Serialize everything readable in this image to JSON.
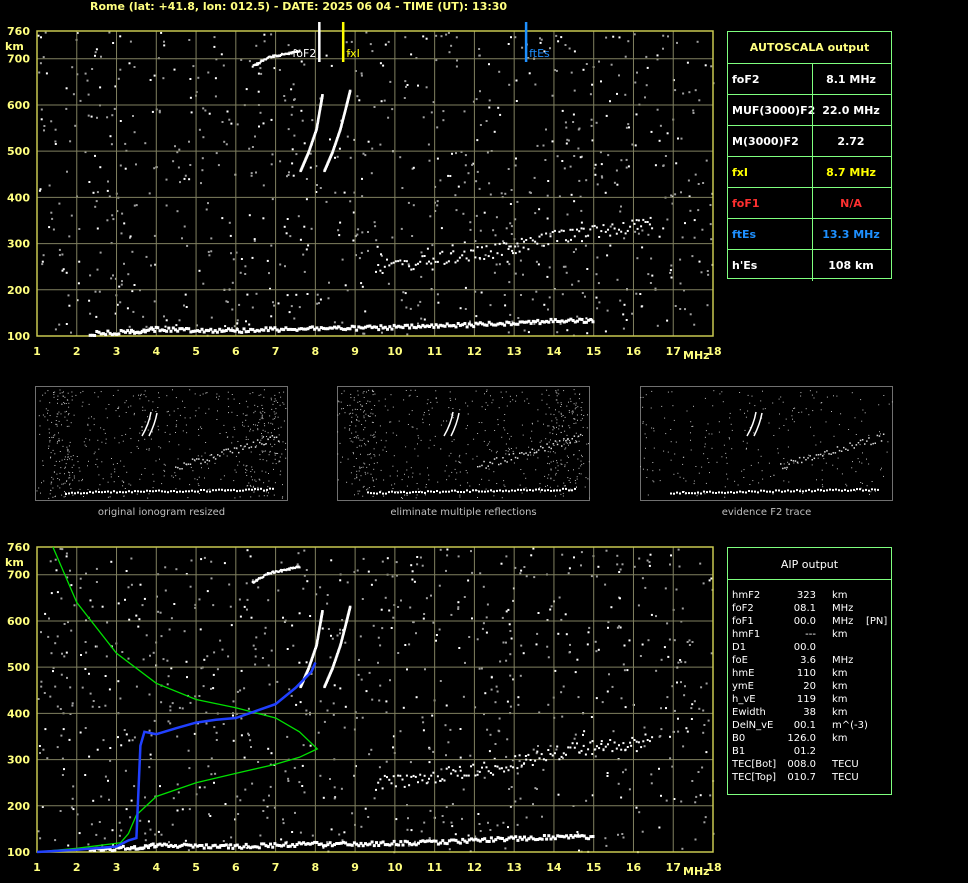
{
  "header": {
    "title": "Rome (lat: +41.8, lon: 012.5) - DATE: 2025 06 04 - TIME (UT): 13:30"
  },
  "colors": {
    "yellow": "#ffff00",
    "red": "#ff3030",
    "blue": "#1e90ff",
    "green": "#7fff7f",
    "grid": "#808060",
    "profile": "#00e000"
  },
  "autoscala": {
    "title": "AUTOSCALA output",
    "rows": [
      {
        "key": "foF2",
        "value": "8.1 MHz",
        "color": "#ffffff"
      },
      {
        "key": "MUF(3000)F2",
        "value": "22.0 MHz",
        "color": "#ffffff"
      },
      {
        "key": "M(3000)F2",
        "value": "2.72",
        "color": "#ffffff"
      },
      {
        "key": "fxI",
        "value": "8.7 MHz",
        "color": "#ffff00"
      },
      {
        "key": "foF1",
        "value": "N/A",
        "color": "#ff3030"
      },
      {
        "key": "ftEs",
        "value": "13.3 MHz",
        "color": "#1e90ff"
      },
      {
        "key": "h'Es",
        "value": "108     km",
        "color": "#ffffff"
      }
    ]
  },
  "aip": {
    "title": "AIP output",
    "rows": [
      {
        "k": "hmF2",
        "v": "323",
        "u": "km",
        "x": ""
      },
      {
        "k": "foF2",
        "v": "08.1",
        "u": "MHz",
        "x": ""
      },
      {
        "k": "foF1",
        "v": "00.0",
        "u": "MHz",
        "x": "[PN]"
      },
      {
        "k": "hmF1",
        "v": "---",
        "u": "km",
        "x": ""
      },
      {
        "k": "D1",
        "v": "00.0",
        "u": "",
        "x": ""
      },
      {
        "k": "foE",
        "v": "3.6",
        "u": "MHz",
        "x": ""
      },
      {
        "k": "hmE",
        "v": "110",
        "u": "km",
        "x": ""
      },
      {
        "k": "ymE",
        "v": "20",
        "u": "km",
        "x": ""
      },
      {
        "k": "h_vE",
        "v": "119",
        "u": "km",
        "x": ""
      },
      {
        "k": "Ewidth",
        "v": "38",
        "u": "km",
        "x": ""
      },
      {
        "k": "DelN_vE",
        "v": "00.1",
        "u": "m^(-3)",
        "x": ""
      },
      {
        "k": "B0",
        "v": "126.0",
        "u": "km",
        "x": ""
      },
      {
        "k": "B1",
        "v": "01.2",
        "u": "",
        "x": ""
      },
      {
        "k": "TEC[Bot]",
        "v": "008.0",
        "u": "TECU",
        "x": ""
      },
      {
        "k": "TEC[Top]",
        "v": "010.7",
        "u": "TECU",
        "x": ""
      }
    ]
  },
  "thumbnails": [
    {
      "caption": "original ionogram resized"
    },
    {
      "caption": "eliminate multiple reflections"
    },
    {
      "caption": "evidence F2 trace"
    }
  ],
  "chart_data": [
    {
      "type": "scatter",
      "name": "ionogram-autoscala",
      "xlabel": "MHz",
      "ylabel": "km",
      "xlim": [
        1,
        18
      ],
      "ylim": [
        100,
        760
      ],
      "xticks": [
        1,
        2,
        3,
        4,
        5,
        6,
        7,
        8,
        9,
        10,
        11,
        12,
        13,
        14,
        15,
        16,
        17,
        18
      ],
      "yticks": [
        100,
        200,
        300,
        400,
        500,
        600,
        700,
        760
      ],
      "markers": [
        {
          "label": "foF2",
          "freq": 8.1,
          "color": "#ffffff"
        },
        {
          "label": "fxI",
          "freq": 8.7,
          "color": "#ffff00"
        },
        {
          "label": "ftEs",
          "freq": 13.3,
          "color": "#1e90ff"
        }
      ],
      "traces": {
        "es_layer": {
          "x": [
            2.3,
            3.3,
            4.0,
            5.0,
            6.0,
            7.0,
            8.0,
            9.0,
            10.0,
            11.0,
            12.0,
            13.0,
            14.0,
            15.0
          ],
          "y": [
            108,
            112,
            118,
            116,
            115,
            118,
            120,
            120,
            122,
            124,
            128,
            132,
            136,
            136
          ]
        },
        "f2_o": {
          "x": [
            7.6,
            7.8,
            8.0,
            8.1,
            8.15
          ],
          "y": [
            460,
            500,
            550,
            600,
            625
          ]
        },
        "f2_x": {
          "x": [
            8.2,
            8.4,
            8.6,
            8.75,
            8.85
          ],
          "y": [
            460,
            500,
            550,
            600,
            635
          ]
        },
        "f2_multiple": {
          "x": [
            6.4,
            6.8,
            7.2,
            7.6
          ],
          "y": [
            685,
            705,
            712,
            720
          ]
        },
        "spread_band": {
          "x": [
            9.5,
            10.5,
            11.5,
            12.5,
            13.5,
            14.5,
            15.5,
            16.5
          ],
          "y": [
            250,
            260,
            275,
            285,
            305,
            325,
            335,
            345
          ]
        }
      }
    },
    {
      "type": "line",
      "name": "ionogram-aip",
      "xlabel": "MHz",
      "ylabel": "km",
      "xlim": [
        1,
        18
      ],
      "ylim": [
        100,
        760
      ],
      "xticks": [
        1,
        2,
        3,
        4,
        5,
        6,
        7,
        8,
        9,
        10,
        11,
        12,
        13,
        14,
        15,
        16,
        17,
        18
      ],
      "yticks": [
        100,
        200,
        300,
        400,
        500,
        600,
        700,
        760
      ],
      "series": [
        {
          "name": "",
          "color": "#00e000",
          "x": [
            1.4,
            2.0,
            3.0,
            4.0,
            5.0,
            6.0,
            7.0,
            7.6,
            8.05,
            7.6,
            7.0,
            6.0,
            5.0,
            4.0,
            3.5,
            3.3,
            3.1,
            2.0,
            1.0
          ],
          "y": [
            760,
            640,
            530,
            465,
            430,
            412,
            390,
            360,
            323,
            305,
            290,
            270,
            250,
            220,
            180,
            140,
            120,
            108,
            100
          ]
        },
        {
          "name": "",
          "color": "#2040ff",
          "x": [
            1.0,
            2.0,
            3.0,
            3.3,
            3.5,
            3.6,
            3.7,
            4.0,
            4.5,
            5.0,
            5.5,
            6.0,
            6.5,
            7.0,
            7.5,
            7.9,
            8.0
          ],
          "y": [
            100,
            105,
            112,
            125,
            130,
            330,
            360,
            355,
            368,
            380,
            386,
            390,
            405,
            420,
            455,
            490,
            510
          ]
        }
      ]
    }
  ]
}
